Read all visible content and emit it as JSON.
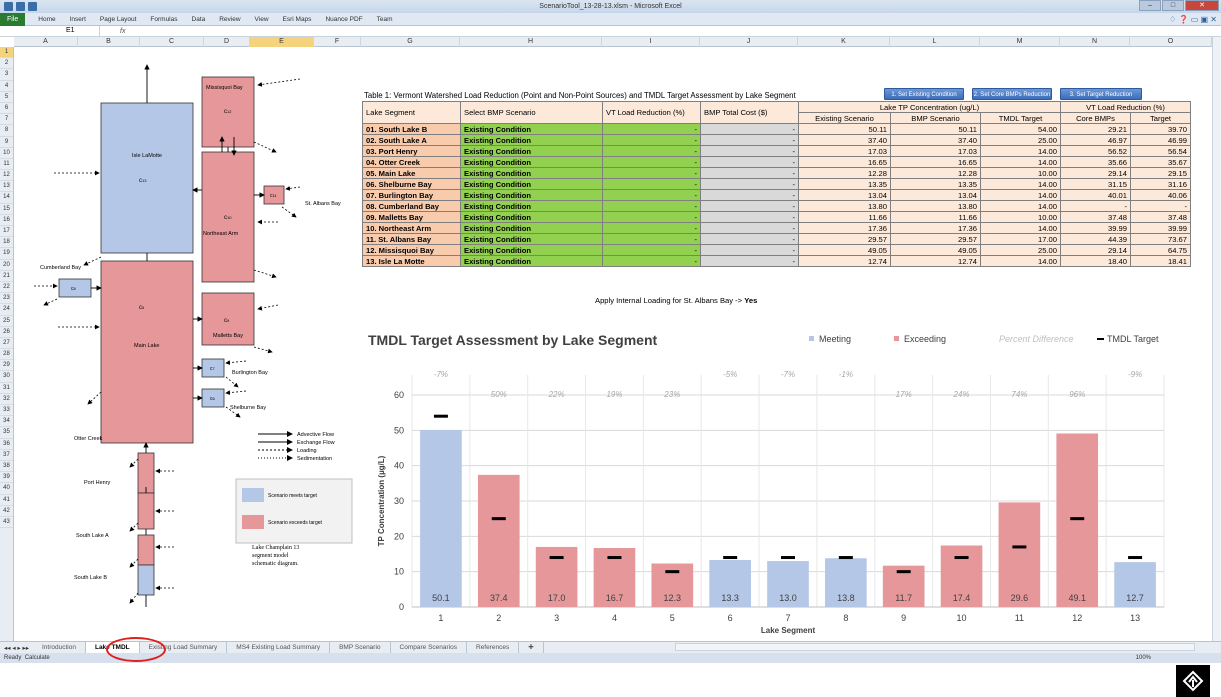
{
  "window": {
    "title": "ScenarioTool_13-28-13.xlsm - Microsoft Excel"
  },
  "ribbon": {
    "file": "File",
    "tabs": [
      "Home",
      "Insert",
      "Page Layout",
      "Formulas",
      "Data",
      "Review",
      "View",
      "Esri Maps",
      "Nuance PDF",
      "Team"
    ]
  },
  "formula_bar": {
    "cell_ref": "E1",
    "fx": "fx"
  },
  "columns": [
    "A",
    "B",
    "C",
    "D",
    "E",
    "F",
    "G",
    "H",
    "I",
    "J",
    "K",
    "L",
    "M",
    "N",
    "O"
  ],
  "rows": [
    "1",
    "2",
    "3",
    "4",
    "5",
    "6",
    "7",
    "8",
    "9",
    "10",
    "11",
    "12",
    "13",
    "14",
    "15",
    "16",
    "17",
    "18",
    "19",
    "20",
    "21",
    "22",
    "23",
    "24",
    "25",
    "26",
    "27",
    "28",
    "29",
    "30",
    "31",
    "32",
    "33",
    "34",
    "35",
    "36",
    "37",
    "38",
    "39",
    "40",
    "41",
    "42",
    "43"
  ],
  "schematic": {
    "blue_color": "#b4c7e7",
    "red_color": "#e6979a",
    "labels": {
      "missisquoi": "Missisquoi Bay",
      "isle": "Isle LaMotte",
      "northeast": "Northeast Arm",
      "stalbans": "St. Albans Bay",
      "cumberland": "Cumberland Bay",
      "malletts": "Malletts Bay",
      "burlington": "Burlington Bay",
      "shelburne": "Shelburne Bay",
      "main": "Main Lake",
      "otter": "Otter Creek",
      "porthenry": "Port Henry",
      "southA": "South Lake A",
      "southB": "South Lake B"
    },
    "legend_flows": [
      "Advective Flow",
      "Exchange Flow",
      "Loading",
      "Sedimentation"
    ],
    "legend_target": [
      "Scenario meets target",
      "Scenario exceeds target"
    ],
    "caption": [
      "Lake Champlain 13",
      "segment model",
      "schematic diagram."
    ]
  },
  "table": {
    "title": "Table 1: Vermont Watershed Load Reduction (Point and Non-Point Sources) and TMDL Target Assessment by Lake Segment",
    "buttons": [
      "1. Set Existing Condition",
      "2. Set Core BMPs Reduction",
      "3. Set Target Reduction"
    ],
    "headers": {
      "segment": "Lake Segment",
      "scenario": "Select BMP Scenario",
      "vt_red": "VT Load Reduction (%)",
      "cost": "BMP Total Cost ($)",
      "tp_group": "Lake TP Concentration (ug/L)",
      "existing": "Existing Scenario",
      "bmp": "BMP Scenario",
      "tmdl": "TMDL Target",
      "vt_group": "VT Load Reduction (%)",
      "core": "Core BMPs",
      "target": "Target"
    },
    "rows": [
      [
        "01. South Lake B",
        "Existing Condition",
        "-",
        "-",
        "50.11",
        "50.11",
        "54.00",
        "29.21",
        "39.70"
      ],
      [
        "02. South Lake A",
        "Existing Condition",
        "-",
        "-",
        "37.40",
        "37.40",
        "25.00",
        "46.97",
        "46.99"
      ],
      [
        "03. Port Henry",
        "Existing Condition",
        "-",
        "-",
        "17.03",
        "17.03",
        "14.00",
        "56.52",
        "56.54"
      ],
      [
        "04. Otter Creek",
        "Existing Condition",
        "-",
        "-",
        "16.65",
        "16.65",
        "14.00",
        "35.66",
        "35.67"
      ],
      [
        "05. Main Lake",
        "Existing Condition",
        "-",
        "-",
        "12.28",
        "12.28",
        "10.00",
        "29.14",
        "29.15"
      ],
      [
        "06. Shelburne Bay",
        "Existing Condition",
        "-",
        "-",
        "13.35",
        "13.35",
        "14.00",
        "31.15",
        "31.16"
      ],
      [
        "07. Burlington Bay",
        "Existing Condition",
        "-",
        "-",
        "13.04",
        "13.04",
        "14.00",
        "40.01",
        "40.06"
      ],
      [
        "08. Cumberland Bay",
        "Existing Condition",
        "-",
        "-",
        "13.80",
        "13.80",
        "14.00",
        "-",
        "-"
      ],
      [
        "09. Malletts Bay",
        "Existing Condition",
        "-",
        "-",
        "11.66",
        "11.66",
        "10.00",
        "37.48",
        "37.48"
      ],
      [
        "10. Northeast Arm",
        "Existing Condition",
        "-",
        "-",
        "17.36",
        "17.36",
        "14.00",
        "39.99",
        "39.99"
      ],
      [
        "11. St. Albans Bay",
        "Existing Condition",
        "-",
        "-",
        "29.57",
        "29.57",
        "17.00",
        "44.39",
        "73.67"
      ],
      [
        "12. Missisquoi Bay",
        "Existing Condition",
        "-",
        "-",
        "49.05",
        "49.05",
        "25.00",
        "29.14",
        "64.75"
      ],
      [
        "13. Isle La Motte",
        "Existing Condition",
        "-",
        "-",
        "12.74",
        "12.74",
        "14.00",
        "18.40",
        "18.41"
      ]
    ],
    "internal_loading": "Apply Internal Loading for St. Albans Bay -> ",
    "internal_loading_value": "Yes"
  },
  "chart_data": {
    "type": "bar",
    "title": "TMDL Target Assessment by Lake Segment",
    "xlabel": "Lake Segment",
    "ylabel": "TP Concentration (µg/L)",
    "ylim": [
      0,
      60
    ],
    "yticks": [
      0,
      10,
      20,
      30,
      40,
      50,
      60
    ],
    "grid": true,
    "legend": [
      "Meeting",
      "Exceeding",
      "Percent Difference",
      "TMDL Target"
    ],
    "legend_position": "top-right",
    "colors": {
      "meeting": "#b4c7e7",
      "exceeding": "#e6979a",
      "target": "#000000",
      "pct": "#a6a6a6"
    },
    "categories": [
      "1",
      "2",
      "3",
      "4",
      "5",
      "6",
      "7",
      "8",
      "9",
      "10",
      "11",
      "12",
      "13"
    ],
    "values": [
      50.1,
      37.4,
      17.0,
      16.7,
      12.3,
      13.3,
      13.0,
      13.8,
      11.7,
      17.4,
      29.6,
      49.1,
      12.7
    ],
    "value_labels": [
      "50.1",
      "37.4",
      "17.0",
      "16.7",
      "12.3",
      "13.3",
      "13.0",
      "13.8",
      "11.7",
      "17.4",
      "29.6",
      "49.1",
      "12.7"
    ],
    "status": [
      "meeting",
      "exceeding",
      "exceeding",
      "exceeding",
      "exceeding",
      "meeting",
      "meeting",
      "meeting",
      "exceeding",
      "exceeding",
      "exceeding",
      "exceeding",
      "meeting"
    ],
    "tmdl_target": [
      54,
      25,
      14,
      14,
      10,
      14,
      14,
      14,
      10,
      14,
      17,
      25,
      14
    ],
    "percent_difference": [
      "-7%",
      "50%",
      "22%",
      "19%",
      "23%",
      "-5%",
      "-7%",
      "-1%",
      "17%",
      "24%",
      "74%",
      "96%",
      "-9%"
    ],
    "percent_row": [
      "top",
      "low",
      "low",
      "low",
      "low",
      "top",
      "top",
      "top",
      "low",
      "low",
      "low",
      "low",
      "top"
    ]
  },
  "sheet_tabs": [
    "Introduction",
    "Lake TMDL",
    "Existing Load Summary",
    "MS4 Existing Load Summary",
    "BMP Scenario",
    "Compare Scenarios",
    "References"
  ],
  "active_tab": "Lake TMDL",
  "status_bar": {
    "ready": "Ready",
    "calc": "Calculate",
    "zoom": "100%"
  }
}
